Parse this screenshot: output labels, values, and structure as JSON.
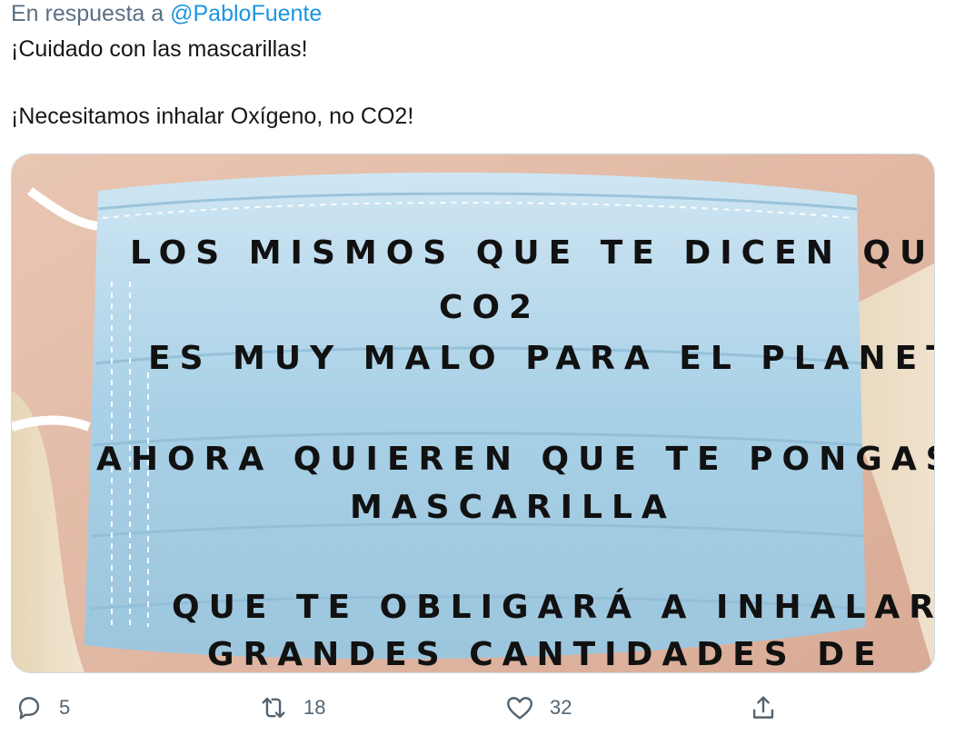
{
  "reply": {
    "prefix": "En respuesta a",
    "handle": "@PabloFuente"
  },
  "tweet": {
    "line1": "¡Cuidado con las mascarillas!",
    "line2": "¡Necesitamos inhalar Oxígeno, no CO2!"
  },
  "image": {
    "lines": [
      "LOS MISMOS QUE TE DICEN QUE EL",
      "CO2",
      "ES MUY MALO PARA EL PLANETA",
      "AHORA QUIEREN QUE TE PONGAS UNA",
      "MASCARILLA",
      "QUE TE OBLIGARÁ A INHALAR",
      "GRANDES CANTIDADES DE"
    ]
  },
  "actions": {
    "reply_count": "5",
    "retweet_count": "18",
    "like_count": "32"
  },
  "colors": {
    "link": "#1b95e0",
    "meta": "#5b7083",
    "icon": "#536471"
  }
}
